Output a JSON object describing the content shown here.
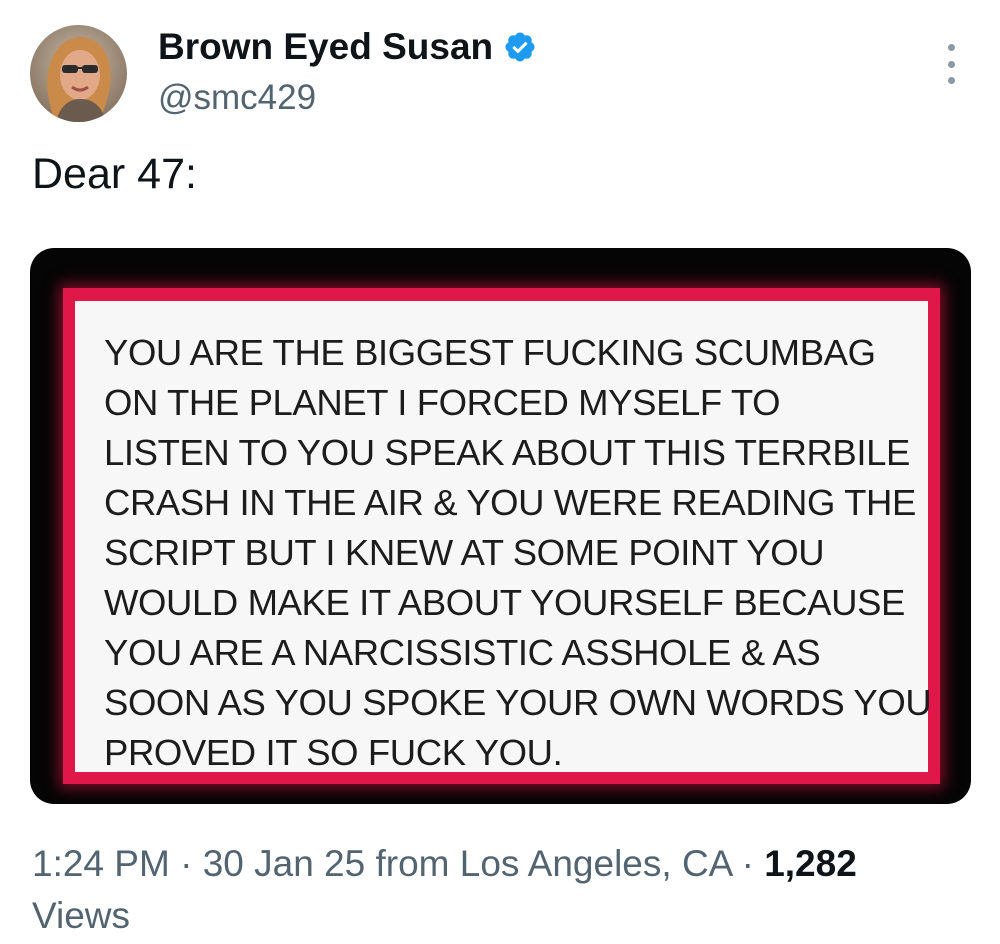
{
  "author": {
    "display_name": "Brown Eyed Susan",
    "handle": "@smc429",
    "verified": true,
    "avatar_icon": "profile-photo",
    "verified_icon": "verified-badge-icon",
    "verified_color": "#1d9bf0"
  },
  "tweet": {
    "text": "Dear 47:",
    "image_text": "YOU ARE THE BIGGEST FUCKING SCUMBAG\nON THE PLANET I FORCED MYSELF TO\nLISTEN TO YOU SPEAK ABOUT THIS TERRBILE\nCRASH IN THE AIR & YOU WERE READING THE\nSCRIPT BUT I KNEW AT SOME POINT YOU\nWOULD MAKE IT ABOUT YOURSELF BECAUSE\nYOU ARE A NARCISSISTIC ASSHOLE & AS\nSOON AS YOU SPOKE YOUR OWN WORDS YOU\nPROVED IT SO FUCK YOU.",
    "image_frame_color": "#e0184a"
  },
  "meta": {
    "time": "1:24 PM",
    "separator": " · ",
    "date": "30 Jan 25",
    "location": " from Los Angeles, CA",
    "views_count": "1,282",
    "views_label": "Views"
  },
  "menu": {
    "icon": "more-options-icon"
  }
}
